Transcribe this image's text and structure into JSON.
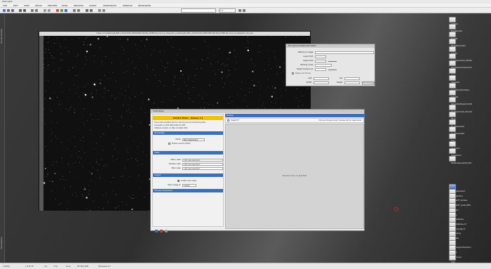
{
  "app": {
    "title": "PixInsight"
  },
  "menu": [
    "FILE",
    "EDIT",
    "VIEW",
    "IMAGE",
    "PREVIEW",
    "MASK",
    "PROCESS",
    "SCRIPT",
    "WORKSPACE",
    "WINDOW",
    "RESOURCES"
  ],
  "toolbar": {
    "zoom_label": "1:4"
  },
  "left_strip": {
    "top_label": "Process Console",
    "bottom_label": "View Explorer"
  },
  "image_window": {
    "title": "Integr 1:4 masterLight_BIN-1_5232x3476_EXPOSURE-300.00s_FILTER-Ha_mono_R_integration_masterLight_BIN-1_5232x3476_EXPOSURE-300.00s_FILTER-Ha_mono_R_integration_00_new"
  },
  "binned_dialog": {
    "title": "BinningCoordinateTransformation",
    "reference_image": "Reference image:",
    "lower_limit": "Lower limit:",
    "upper_limit": "Upper limit:",
    "working_mode": "Working mode:",
    "target_background": "Target background:",
    "checkbox": "Replace all frames",
    "left": "Left:",
    "top": "Top:",
    "width": "Width:",
    "height": "Height:",
    "from_preview": "From Preview"
  },
  "starx_dialog": {
    "title": "Script Dialog",
    "header": "StarNet Metric - Release 1.4",
    "description": "This script evaluates star for removing and reconstructing data.",
    "copyright1": "Copyright (c) 2021 Nikita Misiura 2021",
    "copyright2": "Software creation (c) Mike Cranfield 2022",
    "sections": {
      "parameters": "Parameters",
      "views": "Views",
      "output": "Output",
      "preview": "Preview dimensions"
    },
    "mode_label": "Mode:",
    "mode_value": "Star replacement",
    "checkbox_reverse": "Enable reverse stretch",
    "starry_label": "Starry view:",
    "starry_value": "<No view selected>",
    "starless_label": "Starless view:",
    "starless_value": "<No view selected>",
    "stars_label": "Stars view:",
    "stars_value": "<No view selected>",
    "create_label": "Create new image",
    "image_id_label": "Stars image id:",
    "image_id_value": "<Auto>",
    "preview_title": "Preview",
    "preview_check": "Target 15°",
    "preview_hint": "Click and drag to zoom. Double click to reset zoom.",
    "preview_placeholder": "Starless view not specified"
  },
  "icons_top": [
    "Untitled",
    "Starlessnoise",
    "StarNet",
    "NoiseXterminator",
    "Deflate",
    "Starreplacement_NoStars",
    "SpectrophotometricColorCal",
    "Crop",
    "Unpacked",
    "CurvesTransformation",
    "Pedestal",
    "GeneralizedHyperbolicStretch",
    "BlurXterminator_Normalization",
    "Noise",
    "BlurXterminator",
    "StarXterminator",
    "Crop",
    "Histogram",
    "ImageSolver",
    "MultiscaleLinearTransform"
  ],
  "icons_bottom": [
    "Starreplacement",
    "StarReduction",
    "HT_StarHT_Grideau",
    "HT_StarHT_Linear_BRD",
    "HT_Stars",
    "Curves",
    "CurvesStarless",
    "CurvesStarless_AT",
    "SASBoost_NB_XT",
    "Resampling",
    "StarMask",
    "Invert",
    "MorphologicalTransform",
    "Curves",
    "HDR_Curves",
    "Crop"
  ],
  "status": {
    "coords": "x:0052",
    "scale": "1:4 8.78",
    "bits": "4:1",
    "mode": "7:1C",
    "gray": "Gray",
    "size": "95.965 MiB",
    "workspace": "Workspace 1"
  }
}
